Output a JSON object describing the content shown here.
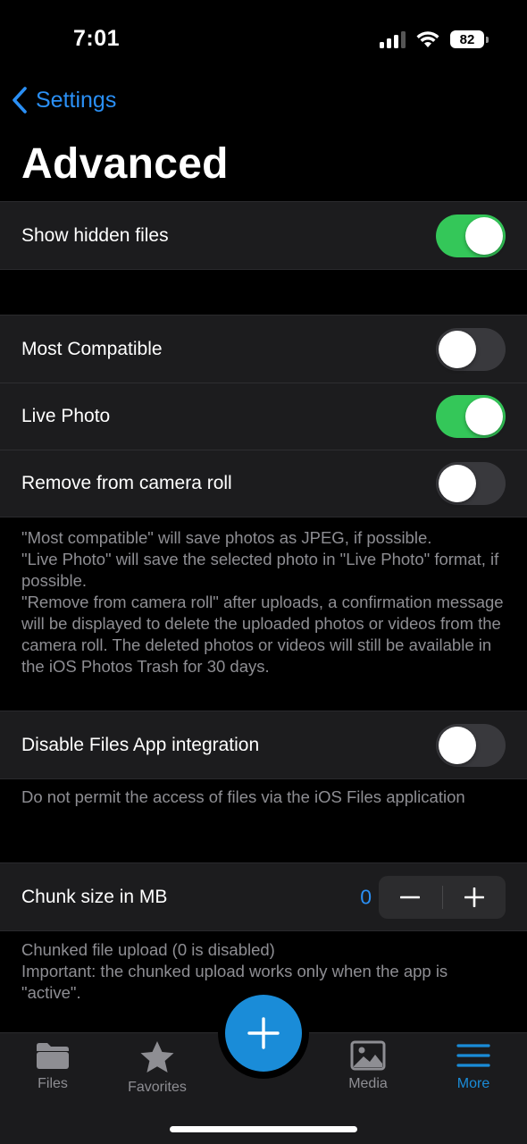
{
  "status_bar": {
    "time": "7:01",
    "battery": "82",
    "icons": [
      "signal-icon",
      "wifi-icon",
      "battery-icon"
    ]
  },
  "nav": {
    "back_label": "Settings",
    "title": "Advanced"
  },
  "hidden_files": {
    "label": "Show hidden files",
    "on": true
  },
  "photo_options": [
    {
      "label": "Most Compatible",
      "on": false
    },
    {
      "label": "Live Photo",
      "on": true
    },
    {
      "label": "Remove from camera roll",
      "on": false
    }
  ],
  "photo_footer": [
    "\"Most compatible\" will save photos as JPEG, if possible.",
    "\"Live Photo\" will save the selected photo in \"Live Photo\" format, if possible.",
    "\"Remove from camera roll\" after uploads, a confirmation message will be displayed to delete the uploaded photos or videos from the camera roll. The deleted photos or videos will still be available in the iOS Photos Trash for 30 days."
  ],
  "files_app": {
    "label": "Disable Files App integration",
    "on": false,
    "footer": "Do not permit the access of files via the iOS Files application"
  },
  "chunk": {
    "label": "Chunk size in MB",
    "value": "0",
    "footer": [
      "Chunked file upload (0 is disabled)",
      "Important: the chunked upload works only when the app is \"active\"."
    ]
  },
  "tab_bar": {
    "tabs": [
      {
        "label": "Files",
        "icon": "folder-icon",
        "active": false
      },
      {
        "label": "Favorites",
        "icon": "star-icon",
        "active": false
      },
      {
        "label": "Media",
        "icon": "photo-icon",
        "active": false
      },
      {
        "label": "More",
        "icon": "menu-icon",
        "active": true
      }
    ],
    "fab_icon": "plus-icon"
  },
  "colors": {
    "accent": "#1a8cd8",
    "toggle_on": "#34c759",
    "cell": "#1c1c1e"
  }
}
